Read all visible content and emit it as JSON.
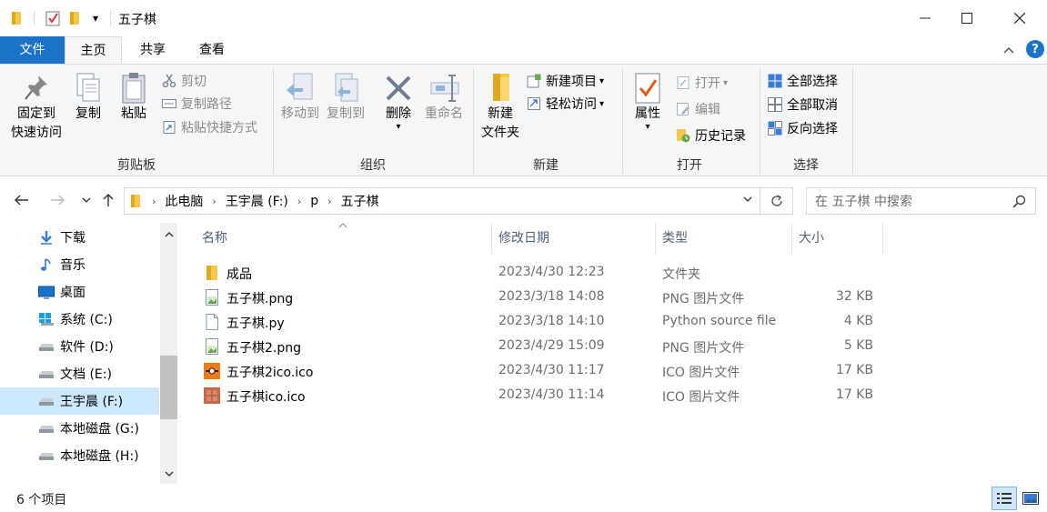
{
  "window": {
    "title": "五子棋",
    "quick_access_dropdown": "▾"
  },
  "tabs": [
    {
      "label": "文件"
    },
    {
      "label": "主页"
    },
    {
      "label": "共享"
    },
    {
      "label": "查看"
    }
  ],
  "ribbon": {
    "clipboard": {
      "label": "剪贴板",
      "pin_line1": "固定到",
      "pin_line2": "快速访问",
      "copy": "复制",
      "paste": "粘贴",
      "cut": "剪切",
      "copy_path": "复制路径",
      "paste_shortcut": "粘贴快捷方式"
    },
    "organize": {
      "label": "组织",
      "move_to": "移动到",
      "copy_to": "复制到",
      "delete": "删除",
      "rename": "重命名"
    },
    "new": {
      "label": "新建",
      "new_folder_line1": "新建",
      "new_folder_line2": "文件夹",
      "new_item": "新建项目",
      "easy_access": "轻松访问"
    },
    "open": {
      "label": "打开",
      "properties": "属性",
      "open": "打开",
      "edit": "编辑",
      "history": "历史记录"
    },
    "select": {
      "label": "选择",
      "select_all": "全部选择",
      "select_none": "全部取消",
      "invert": "反向选择"
    }
  },
  "address": {
    "crumbs": [
      "此电脑",
      "王宇晨 (F:)",
      "p",
      "五子棋"
    ],
    "search_placeholder": "在 五子棋 中搜索"
  },
  "nav": [
    {
      "label": "下载",
      "icon": "download-icon",
      "selected": false
    },
    {
      "label": "音乐",
      "icon": "music-icon",
      "selected": false
    },
    {
      "label": "桌面",
      "icon": "desktop-icon",
      "selected": false
    },
    {
      "label": "系统 (C:)",
      "icon": "windows-drive-icon",
      "selected": false
    },
    {
      "label": "软件 (D:)",
      "icon": "drive-icon",
      "selected": false
    },
    {
      "label": "文档 (E:)",
      "icon": "drive-icon",
      "selected": false
    },
    {
      "label": "王宇晨 (F:)",
      "icon": "drive-icon",
      "selected": true
    },
    {
      "label": "本地磁盘 (G:)",
      "icon": "drive-icon",
      "selected": false
    },
    {
      "label": "本地磁盘 (H:)",
      "icon": "drive-icon",
      "selected": false
    }
  ],
  "columns": {
    "name": "名称",
    "date": "修改日期",
    "type": "类型",
    "size": "大小"
  },
  "files": [
    {
      "name": "成品",
      "date": "2023/4/30 12:23",
      "type": "文件夹",
      "size": "",
      "icon": "folder-icon"
    },
    {
      "name": "五子棋.png",
      "date": "2023/3/18 14:08",
      "type": "PNG 图片文件",
      "size": "32 KB",
      "icon": "png-file-icon"
    },
    {
      "name": "五子棋.py",
      "date": "2023/3/18 14:10",
      "type": "Python source file",
      "size": "4 KB",
      "icon": "python-file-icon"
    },
    {
      "name": "五子棋2.png",
      "date": "2023/4/29 15:09",
      "type": "PNG 图片文件",
      "size": "5 KB",
      "icon": "png-file-icon"
    },
    {
      "name": "五子棋2ico.ico",
      "date": "2023/4/30 11:17",
      "type": "ICO 图片文件",
      "size": "17 KB",
      "icon": "ico-file-orange-icon"
    },
    {
      "name": "五子棋ico.ico",
      "date": "2023/4/30 11:14",
      "type": "ICO 图片文件",
      "size": "17 KB",
      "icon": "ico-file-brown-icon"
    }
  ],
  "status": {
    "item_count": "6 个项目"
  },
  "colors": {
    "accent": "#1a73c9",
    "selection": "#cce8ff",
    "folder": "#f8c74a"
  }
}
